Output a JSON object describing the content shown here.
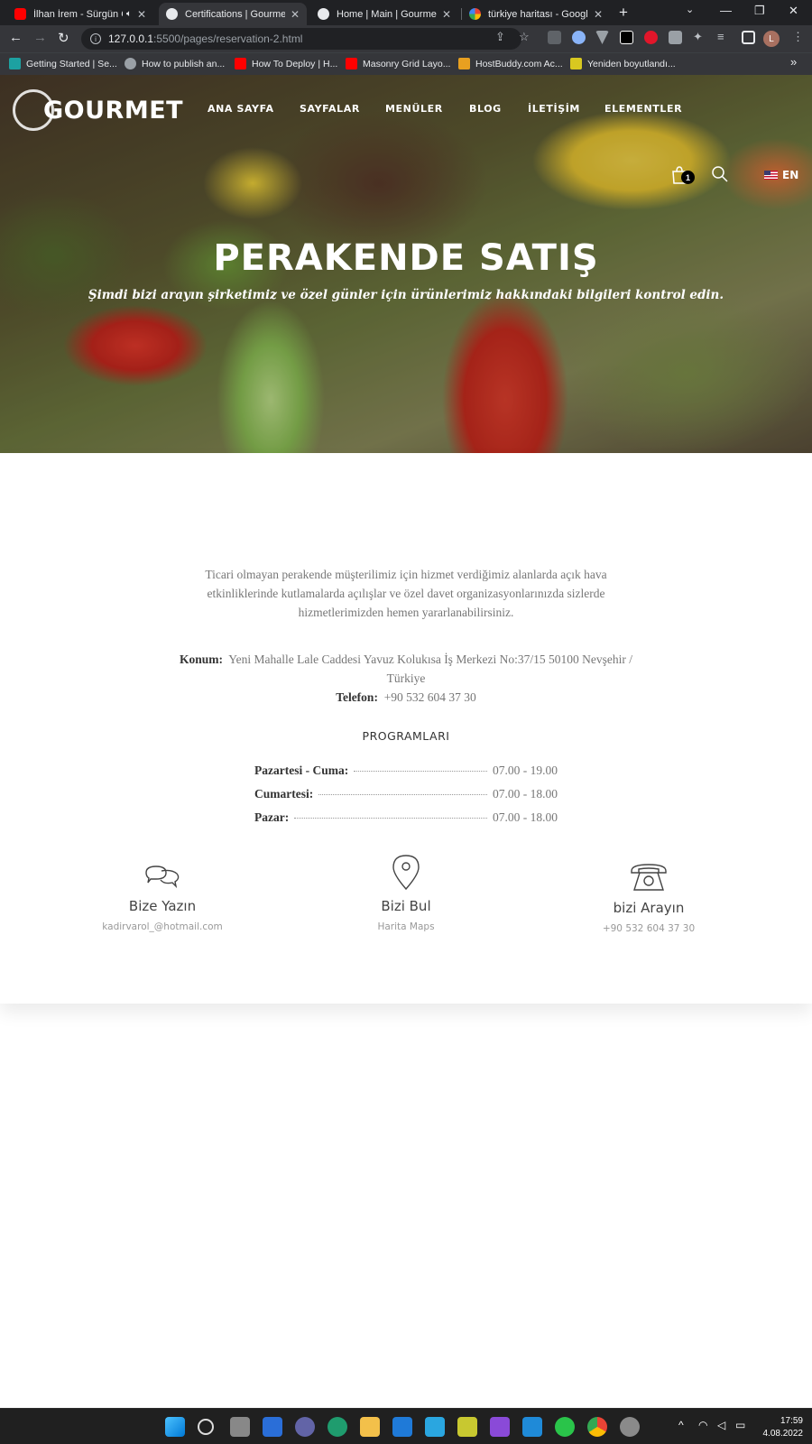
{
  "browser": {
    "tabs": [
      {
        "title": "İlhan İrem - Sürgün G",
        "active": false,
        "favicon": "youtube-icon",
        "color": "#ff0000"
      },
      {
        "title": "Certifications | Gourmet",
        "active": true,
        "favicon": "site-icon",
        "color": "#e8eaed"
      },
      {
        "title": "Home | Main | Gourmet",
        "active": false,
        "favicon": "site-icon",
        "color": "#e8eaed"
      },
      {
        "title": "türkiye haritası - Google A",
        "active": false,
        "favicon": "google-icon",
        "color": "#4285f4"
      }
    ],
    "url_host": "127.0.0.1",
    "url_path": ":5500/pages/reservation-2.html",
    "bookmarks": [
      {
        "label": "Getting Started | Se...",
        "color": "#1da1a1"
      },
      {
        "label": "How to publish an...",
        "color": "#9aa0a6"
      },
      {
        "label": "How To Deploy | H...",
        "color": "#ff0000"
      },
      {
        "label": "Masonry Grid Layo...",
        "color": "#ff0000"
      },
      {
        "label": "HostBuddy.com Ac...",
        "color": "#e8a020"
      },
      {
        "label": "Yeniden boyutlandı...",
        "color": "#d8c820"
      }
    ],
    "bookmarks_more": "»",
    "avatar_letter": "L"
  },
  "site": {
    "logo": "GOURMET",
    "nav": [
      "ANA SAYFA",
      "SAYFALAR",
      "MENÜLER",
      "BLOG",
      "İLETİŞİM",
      "ELEMENTLER"
    ],
    "cart_count": "1",
    "lang": "EN",
    "hero_title": "PERAKENDE SATIŞ",
    "hero_subtitle": "Şimdi bizi arayın şirketimiz ve özel günler için ürünlerimiz hakkındaki bilgileri kontrol edin.",
    "intro": "Ticari olmayan perakende müşterilimiz için hizmet verdiğimiz alanlarda açık hava etkinliklerinde kutlamalarda açılışlar ve özel davet organizasyonlarınızda sizlerde hizmetlerimizden hemen yararlanabilirsiniz.",
    "location_label": "Konum:",
    "location_value": "Yeni Mahalle Lale Caddesi Yavuz Kolukısa İş Merkezi No:37/15 50100 Nevşehir / Türkiye",
    "phone_label": "Telefon:",
    "phone_value": "+90 532 604 37 30",
    "programs_title": "PROGRAMLARI",
    "schedule": [
      {
        "day": "Pazartesi - Cuma:",
        "hours": "07.00 - 19.00"
      },
      {
        "day": "Cumartesi:",
        "hours": "07.00 - 18.00"
      },
      {
        "day": "Pazar:",
        "hours": "07.00 - 18.00"
      }
    ],
    "contacts": [
      {
        "icon": "chat-icon",
        "title": "Bize Yazın",
        "sub": "kadirvarol_@hotmail.com"
      },
      {
        "icon": "map-pin-icon",
        "title": "Bizi Bul",
        "sub": "Harita Maps"
      },
      {
        "icon": "telephone-icon",
        "title": "bizi Arayın",
        "sub": "+90 532 604 37 30"
      }
    ]
  },
  "taskbar": {
    "time": "17:59",
    "date": "4.08.2022"
  }
}
